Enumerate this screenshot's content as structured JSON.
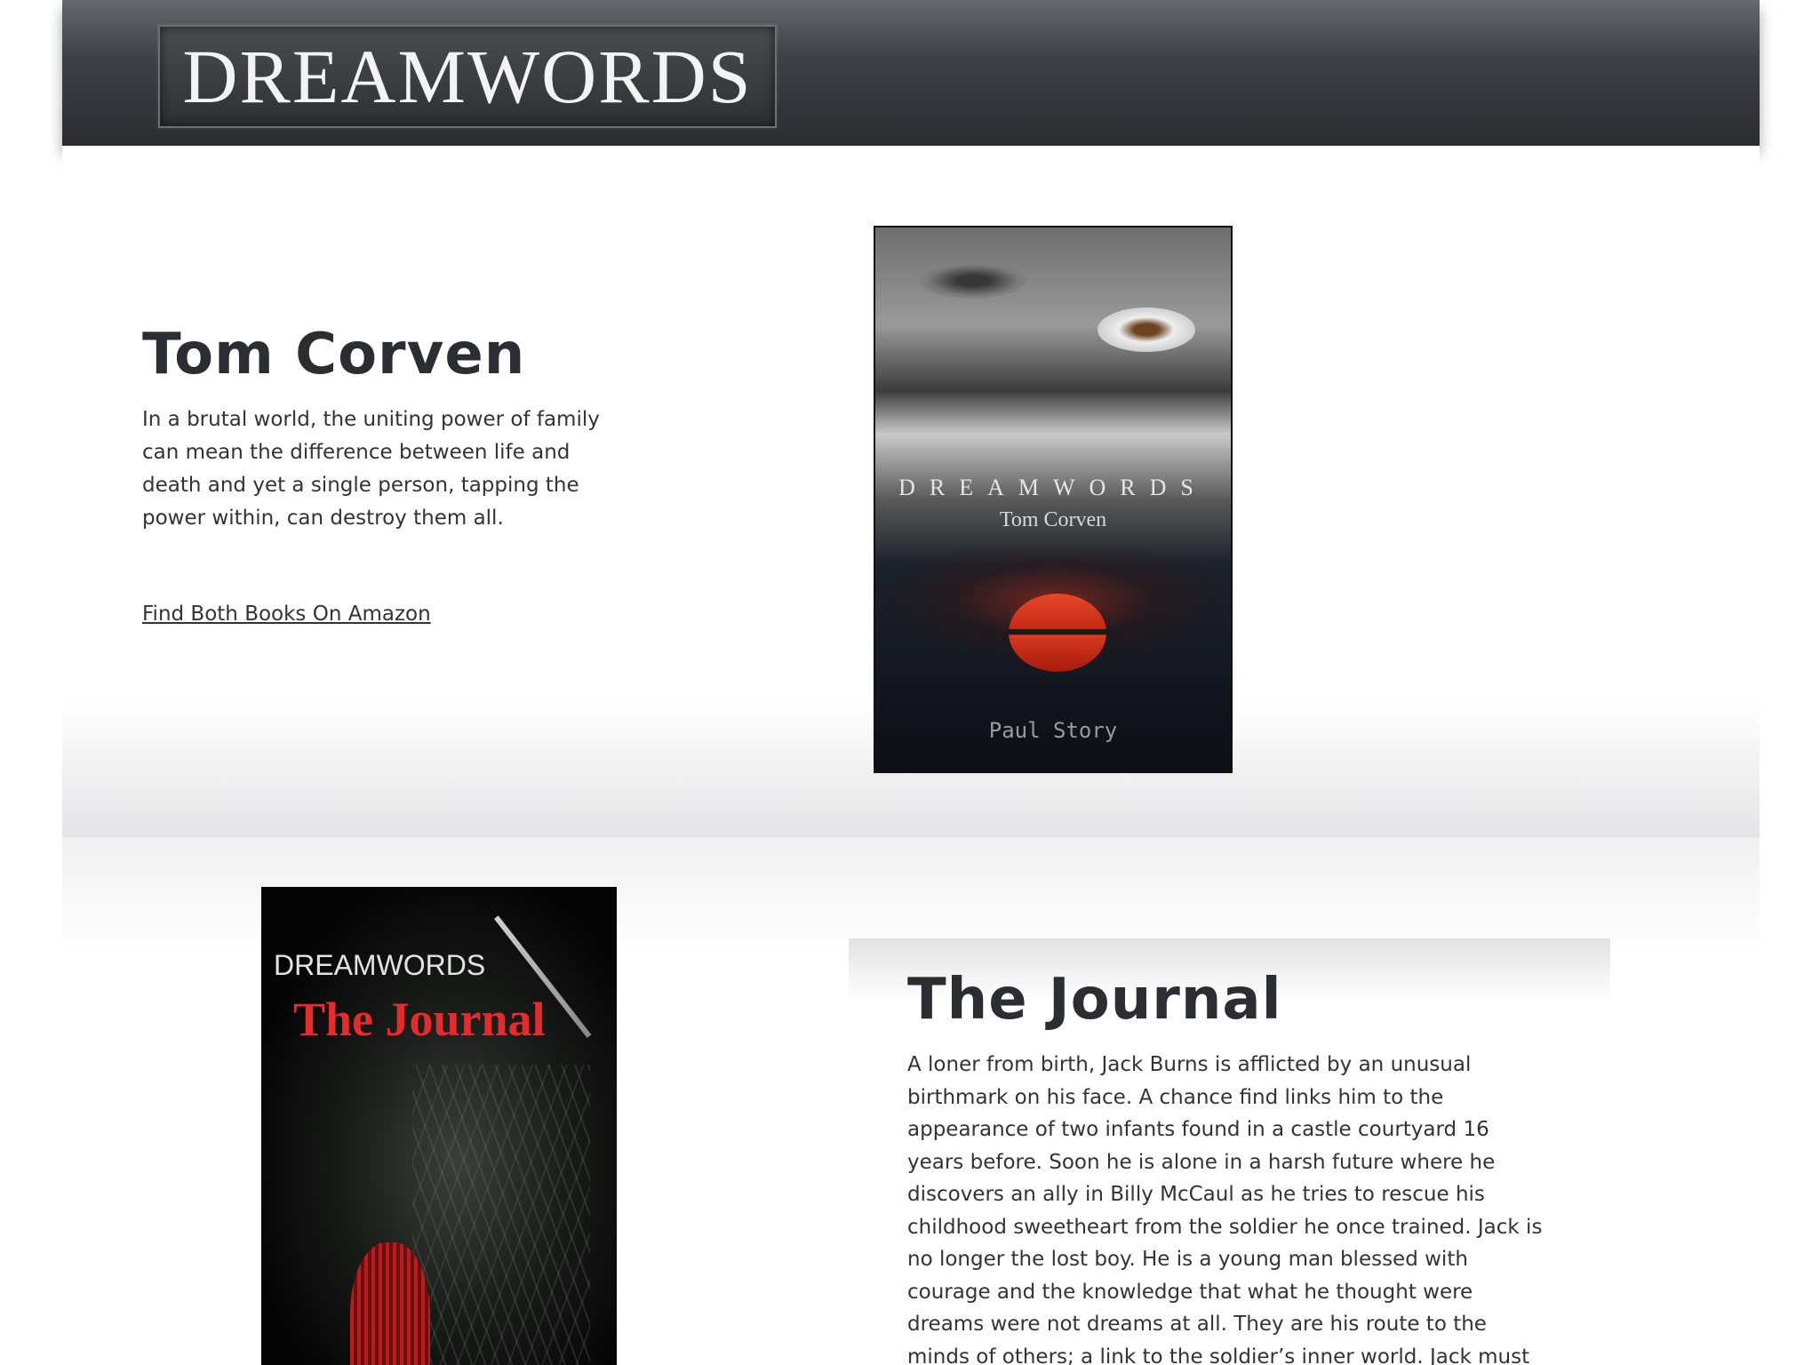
{
  "header": {
    "logo_text": "DREAMWORDS"
  },
  "section1": {
    "title": "Tom Corven",
    "description": "In a brutal world, the uniting power of family can mean the difference between life and death and yet a single person, tapping the power within, can destroy them all.",
    "link_label": "Find Both Books On Amazon",
    "cover": {
      "series": "DREAMWORDS",
      "title": "Tom Corven",
      "author": "Paul Story"
    }
  },
  "section2": {
    "title": "The Journal",
    "description": "A loner from birth, Jack Burns is afflicted by an unusual birthmark on his face. A chance find links him to the appearance of two infants found in a castle courtyard 16 years before. Soon he is alone in a harsh future where he discovers an ally in Billy McCaul as he tries to rescue his childhood sweetheart from the soldier he once trained. Jack is no longer the lost boy. He is a young man blessed with courage and the knowledge that what he thought were dreams were not dreams at all. They are his route to the minds of others; a link to the soldier’s inner world. Jack must find a way to destroy those links even as an army of",
    "cover": {
      "series": "DREAMWORDS",
      "title": "The Journal"
    }
  }
}
